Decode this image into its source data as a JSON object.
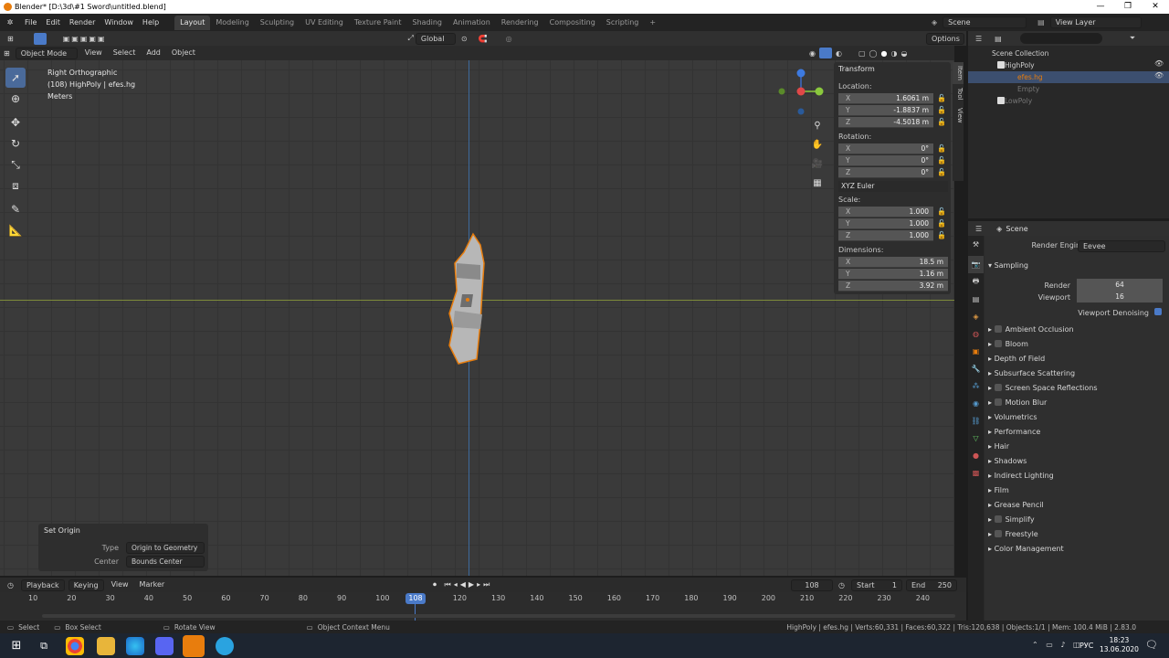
{
  "window": {
    "title": "Blender* [D:\\3d\\#1 Sword\\untitled.blend]",
    "minimize": "—",
    "restore": "❐",
    "close": "✕"
  },
  "menubar": {
    "items": [
      "File",
      "Edit",
      "Render",
      "Window",
      "Help"
    ],
    "workspaces": [
      "Layout",
      "Modeling",
      "Sculpting",
      "UV Editing",
      "Texture Paint",
      "Shading",
      "Animation",
      "Rendering",
      "Compositing",
      "Scripting"
    ],
    "add": "+",
    "scene": "Scene",
    "view_layer": "View Layer"
  },
  "toolheader": {
    "orientation": "Global",
    "options": "Options"
  },
  "viewport_header": {
    "mode": "Object Mode",
    "menus": [
      "View",
      "Select",
      "Add",
      "Object"
    ]
  },
  "viewport_info": {
    "view": "Right Orthographic",
    "object": "(108) HighPoly | efes.hg",
    "units": "Meters"
  },
  "npanel": {
    "title": "Transform",
    "location_label": "Location:",
    "location": [
      {
        "axis": "X",
        "value": "1.6061 m"
      },
      {
        "axis": "Y",
        "value": "-1.8837 m"
      },
      {
        "axis": "Z",
        "value": "-4.5018 m"
      }
    ],
    "rotation_label": "Rotation:",
    "rotation": [
      {
        "axis": "X",
        "value": "0°"
      },
      {
        "axis": "Y",
        "value": "0°"
      },
      {
        "axis": "Z",
        "value": "0°"
      }
    ],
    "rotation_mode": "XYZ Euler",
    "scale_label": "Scale:",
    "scale": [
      {
        "axis": "X",
        "value": "1.000"
      },
      {
        "axis": "Y",
        "value": "1.000"
      },
      {
        "axis": "Z",
        "value": "1.000"
      }
    ],
    "dimensions_label": "Dimensions:",
    "dimensions": [
      {
        "axis": "X",
        "value": "18.5 m"
      },
      {
        "axis": "Y",
        "value": "1.16 m"
      },
      {
        "axis": "Z",
        "value": "3.92 m"
      }
    ],
    "tabs": [
      "Item",
      "Tool",
      "View"
    ]
  },
  "set_origin": {
    "title": "Set Origin",
    "type_label": "Type",
    "type_value": "Origin to Geometry",
    "center_label": "Center",
    "center_value": "Bounds Center"
  },
  "outliner": {
    "rows": [
      "Scene Collection",
      "HighPoly",
      "efes.hg",
      "Empty",
      "LowPoly"
    ]
  },
  "properties": {
    "header": "Scene",
    "render_engine_label": "Render Engine",
    "render_engine": "Eevee",
    "sampling": "Sampling",
    "render_label": "Render",
    "render_value": "64",
    "viewport_label": "Viewport",
    "viewport_value": "16",
    "denoise": "Viewport Denoising",
    "sections": [
      {
        "label": "Ambient Occlusion",
        "cb": true
      },
      {
        "label": "Bloom",
        "cb": true
      },
      {
        "label": "Depth of Field",
        "cb": false
      },
      {
        "label": "Subsurface Scattering",
        "cb": false
      },
      {
        "label": "Screen Space Reflections",
        "cb": true
      },
      {
        "label": "Motion Blur",
        "cb": true
      },
      {
        "label": "Volumetrics",
        "cb": false
      },
      {
        "label": "Performance",
        "cb": false
      },
      {
        "label": "Hair",
        "cb": false
      },
      {
        "label": "Shadows",
        "cb": false
      },
      {
        "label": "Indirect Lighting",
        "cb": false
      },
      {
        "label": "Film",
        "cb": false
      },
      {
        "label": "Grease Pencil",
        "cb": false
      },
      {
        "label": "Simplify",
        "cb": true
      },
      {
        "label": "Freestyle",
        "cb": true
      },
      {
        "label": "Color Management",
        "cb": false
      }
    ]
  },
  "timeline": {
    "menus": [
      "Playback",
      "Keying",
      "View",
      "Marker"
    ],
    "current": "108",
    "start_label": "Start",
    "start": "1",
    "end_label": "End",
    "end": "250",
    "frames": [
      "10",
      "20",
      "30",
      "40",
      "50",
      "60",
      "70",
      "80",
      "90",
      "100",
      "120",
      "130",
      "140",
      "150",
      "160",
      "170",
      "180",
      "190",
      "200",
      "210",
      "220",
      "230",
      "240"
    ],
    "playhead": "108"
  },
  "statusbar": {
    "select": "Select",
    "box": "Box Select",
    "rotate": "Rotate View",
    "context": "Object Context Menu",
    "stats": "HighPoly | efes.hg | Verts:60,331 | Faces:60,322 | Tris:120,638 | Objects:1/1 | Mem: 100.4 MiB | 2.83.0"
  },
  "taskbar": {
    "lang": "РУС",
    "time": "18:23",
    "date": "13.06.2020"
  },
  "colors": {
    "accent": "#4a7ac8",
    "selection": "#e87d0d",
    "bg": "#3a3a3a"
  }
}
